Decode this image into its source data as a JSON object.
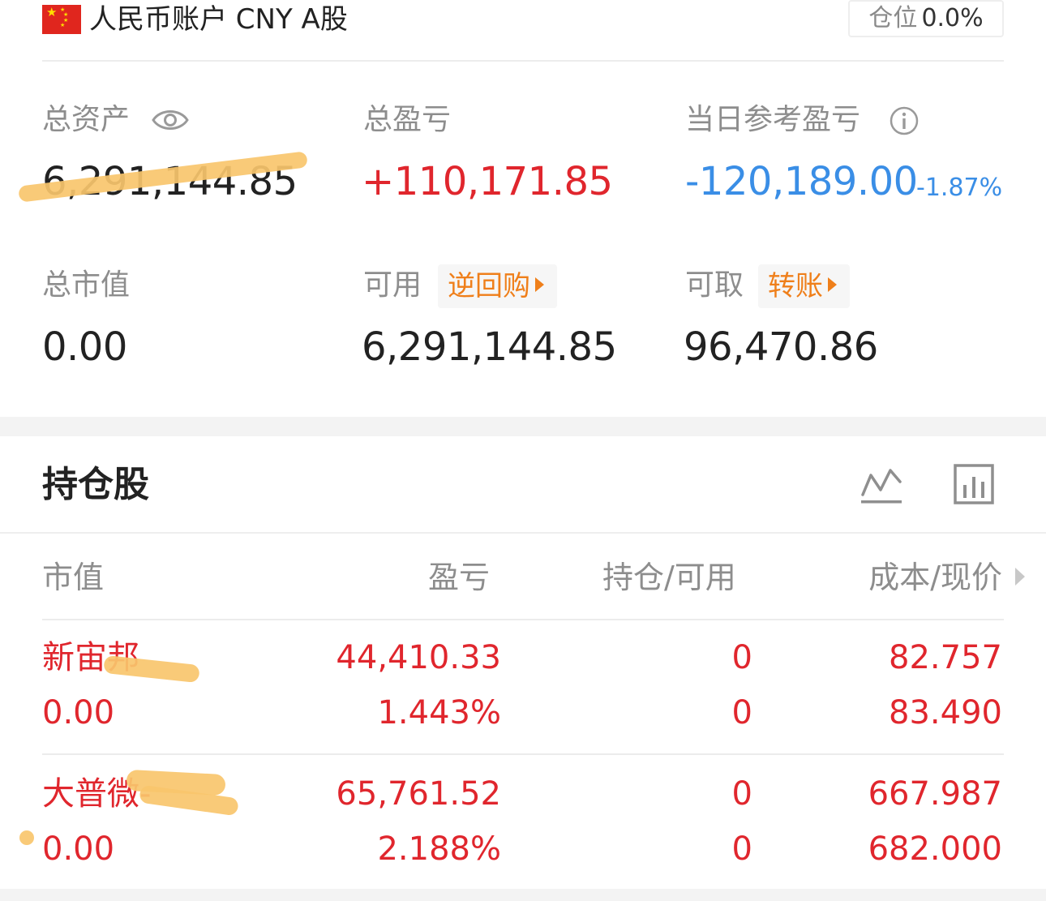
{
  "account": {
    "title": "人民币账户 CNY A股",
    "position_label": "仓位",
    "position_value": "0.0%",
    "flag_icon": "china-flag-icon"
  },
  "summary": {
    "total_assets_label": "总资产",
    "total_assets_value": "6,291,144.85",
    "total_pnl_label": "总盈亏",
    "total_pnl_value": "+110,171.85",
    "daily_pnl_label": "当日参考盈亏",
    "daily_pnl_value": "-120,189.00",
    "daily_pnl_pct": "-1.87%",
    "market_value_label": "总市值",
    "market_value_value": "0.00",
    "available_label": "可用",
    "available_value": "6,291,144.85",
    "reverse_repo_label": "逆回购",
    "withdrawable_label": "可取",
    "withdrawable_value": "96,470.86",
    "transfer_label": "转账"
  },
  "holdings": {
    "title": "持仓股",
    "columns": [
      "市值",
      "盈亏",
      "持仓/可用",
      "成本/现价"
    ],
    "rows": [
      {
        "name": "新宙邦",
        "market_value": "0.00",
        "pnl": "44,410.33",
        "pnl_pct": "1.443%",
        "position": "0",
        "available": "0",
        "cost": "82.757",
        "price": "83.490"
      },
      {
        "name": "大普微-",
        "market_value": "0.00",
        "pnl": "65,761.52",
        "pnl_pct": "2.188%",
        "position": "0",
        "available": "0",
        "cost": "667.987",
        "price": "682.000"
      }
    ]
  },
  "colors": {
    "up_red": "#e0262d",
    "down_blue": "#3a8ee6",
    "action_orange": "#ef7f1a",
    "label_gray": "#8d8d8d"
  }
}
